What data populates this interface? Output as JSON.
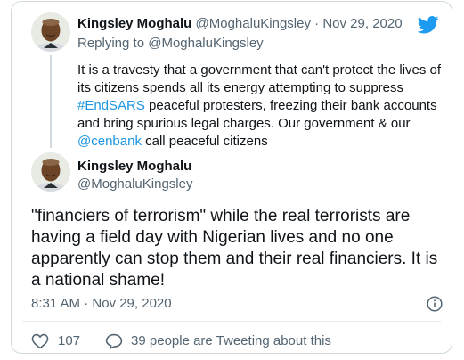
{
  "parent_tweet": {
    "author_name": "Kingsley Moghalu",
    "author_handle": "@MoghaluKingsley",
    "separator": "·",
    "date": "Nov 29, 2020",
    "replying_to_prefix": "Replying to ",
    "replying_to_handle": "@MoghaluKingsley",
    "text_part1": "It is a travesty that a government that can't protect the lives of its citizens spends all its energy attempting to suppress ",
    "hashtag": "#EndSARS",
    "text_part2": " peaceful protesters, freezing their bank accounts and bring spurious legal charges. Our government & our ",
    "mention": "@cenbank",
    "text_part3": " call peaceful citizens"
  },
  "main_tweet": {
    "author_name": "Kingsley Moghalu",
    "author_handle": "@MoghaluKingsley",
    "text": "\"financiers of terrorism\" while the real terrorists are having a field day with Nigerian lives and no one apparently can stop them and their real financiers. It is a national shame!",
    "timestamp": "8:31 AM · Nov 29, 2020"
  },
  "footer": {
    "like_count": "107",
    "conversation_label": "39 people are Tweeting about this"
  },
  "icons": {
    "brand": "twitter-bird-icon",
    "info": "info-icon",
    "like": "heart-icon",
    "conversation": "speech-bubble-icon"
  },
  "colors": {
    "link": "#1b95e0",
    "brand": "#1d9bf0",
    "muted": "#536471",
    "text": "#0f1419",
    "border": "#cfd9de"
  }
}
